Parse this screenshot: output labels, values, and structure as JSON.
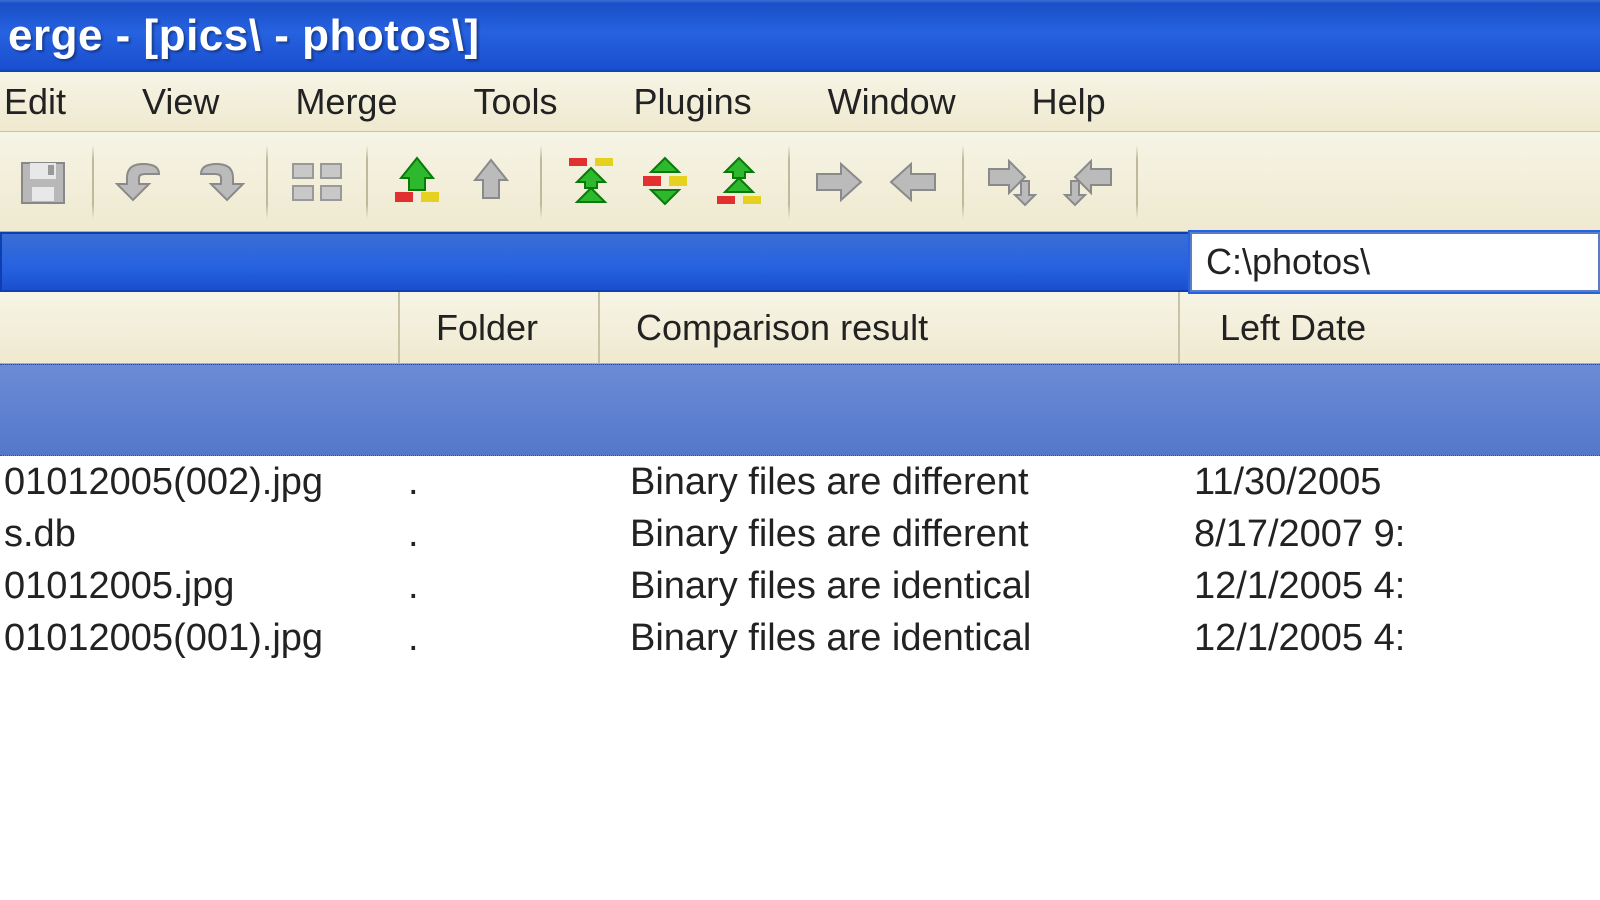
{
  "window": {
    "title": "erge - [pics\\ - photos\\]"
  },
  "menu": {
    "items": [
      "Edit",
      "View",
      "Merge",
      "Tools",
      "Plugins",
      "Window",
      "Help"
    ]
  },
  "toolbar": {
    "icons": [
      "save-icon",
      "undo-icon",
      "redo-icon",
      "panes-icon",
      "diff-down-icon",
      "diff-up-icon",
      "first-diff-icon",
      "current-diff-icon",
      "last-diff-icon",
      "copy-right-icon",
      "copy-left-icon",
      "merge-right-icon",
      "merge-left-icon"
    ]
  },
  "path": {
    "right": "C:\\photos\\"
  },
  "columns": {
    "folder": "Folder",
    "result": "Comparison result",
    "date": "Left Date"
  },
  "rows": [
    {
      "name": "01012005(002).jpg",
      "folder": ".",
      "result": "Binary files are different",
      "date": "11/30/2005 "
    },
    {
      "name": "s.db",
      "folder": ".",
      "result": "Binary files are different",
      "date": "8/17/2007 9:"
    },
    {
      "name": "01012005.jpg",
      "folder": ".",
      "result": "Binary files are identical",
      "date": "12/1/2005 4:"
    },
    {
      "name": "01012005(001).jpg",
      "folder": ".",
      "result": "Binary files are identical",
      "date": "12/1/2005 4:"
    }
  ]
}
